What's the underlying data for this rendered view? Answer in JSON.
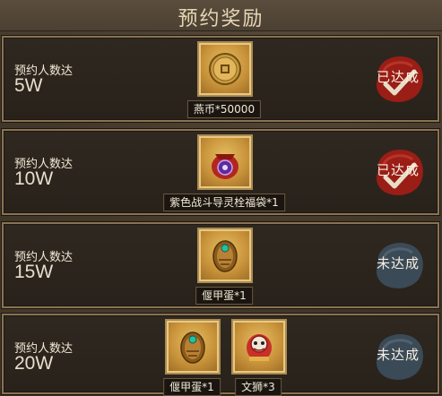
{
  "header": {
    "title": "预约奖励"
  },
  "rows": [
    {
      "label": "预约人数达",
      "target": "5W",
      "status": "已达成",
      "achieved": true,
      "items": [
        {
          "name": "燕币*50000",
          "icon": "coin-icon"
        }
      ]
    },
    {
      "label": "预约人数达",
      "target": "10W",
      "status": "已达成",
      "achieved": true,
      "items": [
        {
          "name": "紫色战斗导灵栓福袋*1",
          "icon": "lucky-bag-icon"
        }
      ]
    },
    {
      "label": "预约人数达",
      "target": "15W",
      "status": "未达成",
      "achieved": false,
      "items": [
        {
          "name": "偃甲蛋*1",
          "icon": "mech-egg-icon"
        }
      ]
    },
    {
      "label": "预约人数达",
      "target": "20W",
      "status": "未达成",
      "achieved": false,
      "items": [
        {
          "name": "偃甲蛋*1",
          "icon": "mech-egg-icon"
        },
        {
          "name": "文狮*3",
          "icon": "lion-dance-icon"
        }
      ]
    }
  ],
  "colors": {
    "achieved_stamp": "#9a1d16",
    "unachieved_stamp": "#3b4a57",
    "frame_gold": "#ab8a52"
  }
}
